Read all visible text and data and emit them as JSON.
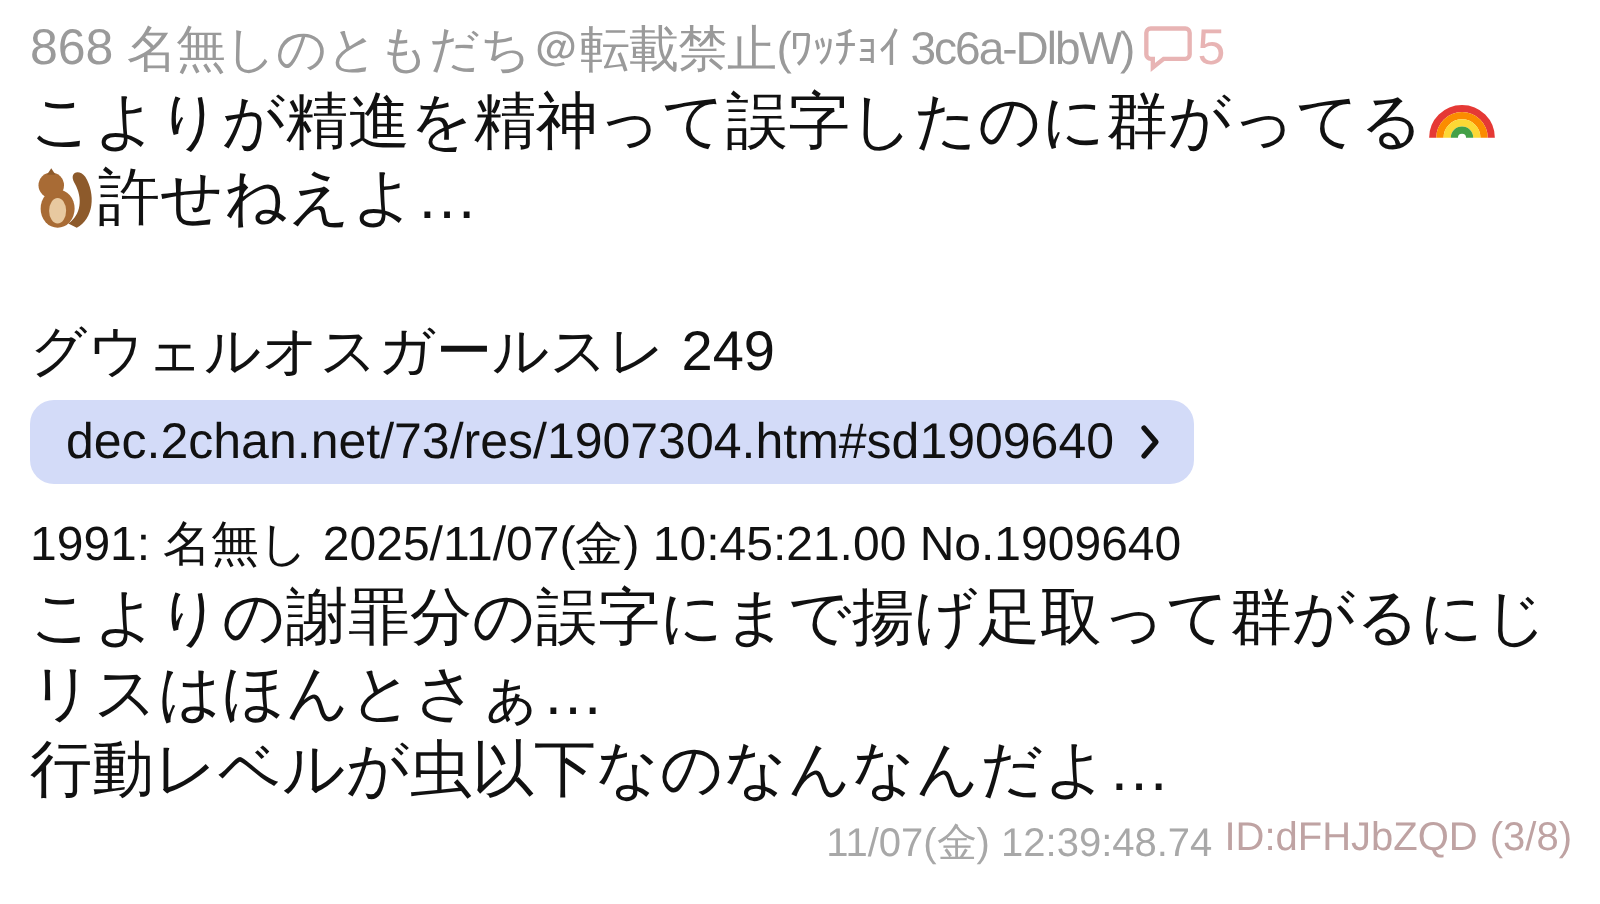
{
  "post": {
    "number": "868",
    "name": "名無しのともだち＠転載禁止",
    "id_tag": "(ﾜｯﾁｮｲ 3c6a-DlbW)",
    "reply_count": "5",
    "comment_lines": [
      [
        {
          "kind": "text",
          "text": "こよりが精進を精神って誤字したのに群がってる"
        },
        {
          "kind": "rainbow"
        }
      ],
      [
        {
          "kind": "chipmunk"
        },
        {
          "kind": "text",
          "text": "許せねえよ…"
        }
      ]
    ],
    "thread_title": "グウェルオスガールスレ 249",
    "link": "dec.2chan.net/73/res/1907304.htm#sd1909640",
    "quote_header": "1991: 名無し 2025/11/07(金) 10:45:21.00 No.1909640",
    "quote_lines": [
      "こよりの謝罪分の誤字にまで揚げ足取って群がるにじ",
      "リスはほんとさぁ…",
      "行動レベルが虫以下なのなんなんだよ…"
    ],
    "timestamp": "11/07(金) 12:39:48.74",
    "poster_id": "ID:dFHJbZQD",
    "position": "(3/8)"
  }
}
